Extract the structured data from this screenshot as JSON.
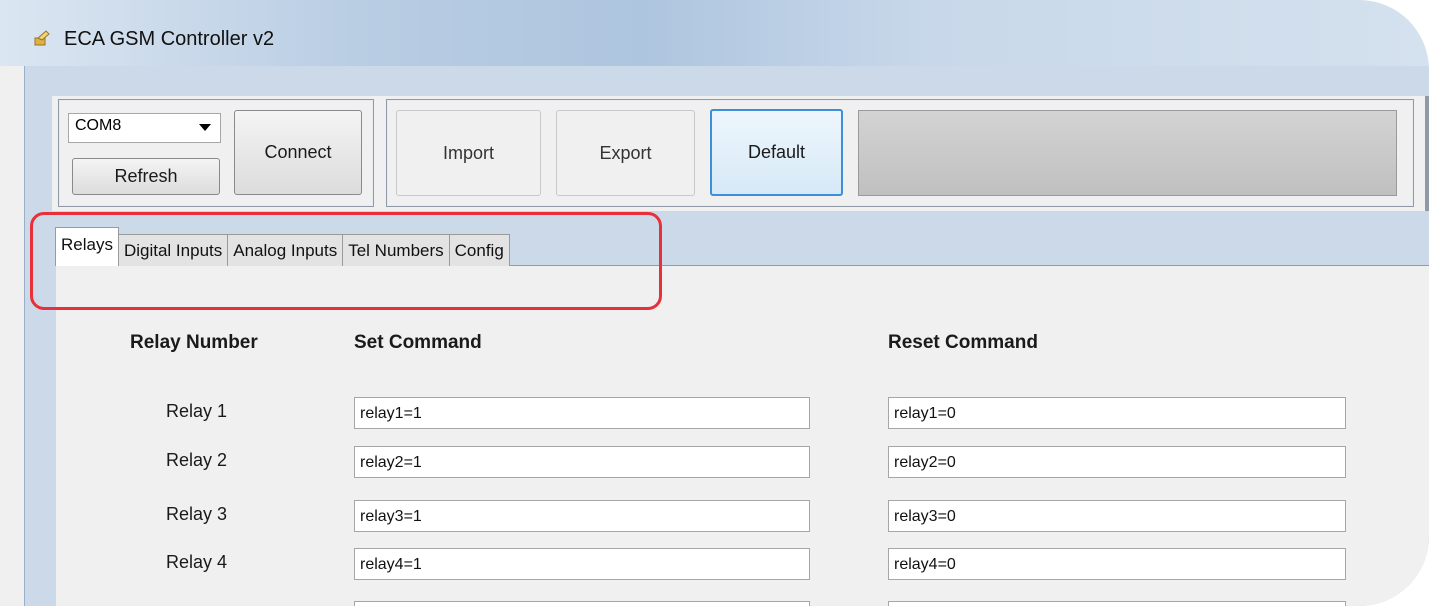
{
  "window": {
    "title": "ECA GSM Controller v2"
  },
  "connection": {
    "port_value": "COM8",
    "connect_label": "Connect",
    "refresh_label": "Refresh"
  },
  "actions": {
    "import_label": "Import",
    "export_label": "Export",
    "default_label": "Default"
  },
  "tabs": [
    {
      "label": "Relays",
      "active": true
    },
    {
      "label": "Digital Inputs"
    },
    {
      "label": "Analog Inputs"
    },
    {
      "label": "Tel Numbers"
    },
    {
      "label": "Config"
    }
  ],
  "relays": {
    "headers": {
      "relay_number": "Relay Number",
      "set_command": "Set Command",
      "reset_command": "Reset Command"
    },
    "rows": [
      {
        "label": "Relay 1",
        "set": "relay1=1",
        "reset": "relay1=0"
      },
      {
        "label": "Relay 2",
        "set": "relay2=1",
        "reset": "relay2=0"
      },
      {
        "label": "Relay 3",
        "set": "relay3=1",
        "reset": "relay3=0"
      },
      {
        "label": "Relay 4",
        "set": "relay4=1",
        "reset": "relay4=0"
      }
    ]
  },
  "colors": {
    "highlight": "#e8303a",
    "default_button_border": "#3c8fd8"
  }
}
